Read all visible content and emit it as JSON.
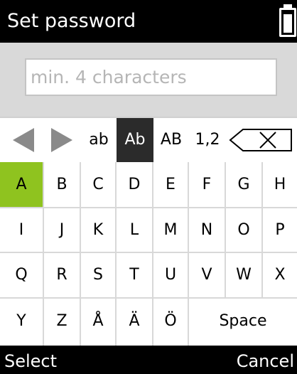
{
  "header": {
    "title": "Set password",
    "battery_icon": "battery-full-icon"
  },
  "password_field": {
    "value": "",
    "placeholder": "min. 4 characters"
  },
  "modes": [
    "ab",
    "Ab",
    "AB",
    "1,2"
  ],
  "selected_mode": "Ab",
  "nav": {
    "left_icon": "arrow-left-icon",
    "right_icon": "arrow-right-icon",
    "backspace_icon": "backspace-icon"
  },
  "keys": {
    "row1": [
      "A",
      "B",
      "C",
      "D",
      "E",
      "F",
      "G",
      "H"
    ],
    "row2": [
      "I",
      "J",
      "K",
      "L",
      "M",
      "N",
      "O",
      "P"
    ],
    "row3": [
      "Q",
      "R",
      "S",
      "T",
      "U",
      "V",
      "W",
      "X"
    ],
    "row4": [
      "Y",
      "Z",
      "Å",
      "Ä",
      "Ö"
    ],
    "space": "Space"
  },
  "selected_key": "A",
  "softkeys": {
    "left": "Select",
    "right": "Cancel"
  },
  "colors": {
    "highlight": "#8fc31f",
    "mode_selected": "#2b2b2b"
  }
}
